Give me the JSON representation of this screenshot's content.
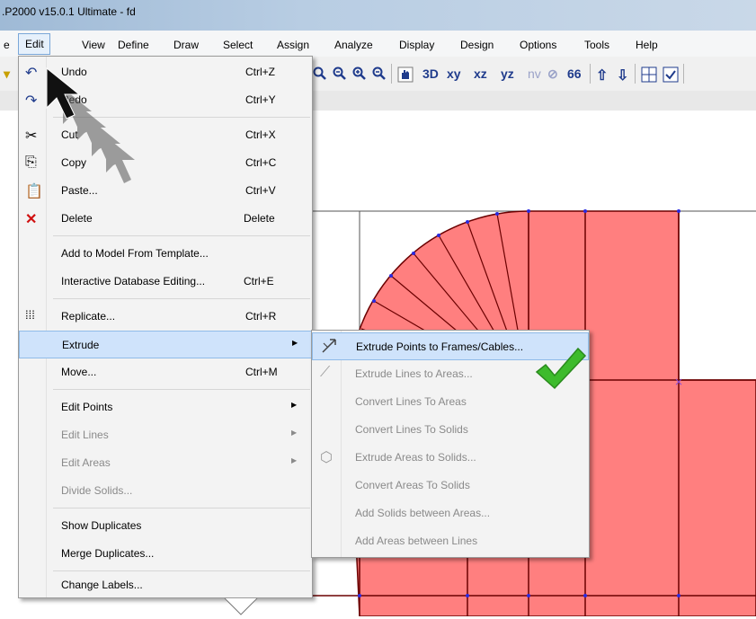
{
  "window": {
    "title": ".P2000 v15.0.1 Ultimate  - fd"
  },
  "menubar": {
    "items": [
      {
        "label": "e"
      },
      {
        "label": "Edit"
      },
      {
        "label": "View"
      },
      {
        "label": "Define"
      },
      {
        "label": "Draw"
      },
      {
        "label": "Select"
      },
      {
        "label": "Assign"
      },
      {
        "label": "Analyze"
      },
      {
        "label": "Display"
      },
      {
        "label": "Design"
      },
      {
        "label": "Options"
      },
      {
        "label": "Tools"
      },
      {
        "label": "Help"
      }
    ]
  },
  "toolbar": {
    "text_buttons": [
      "3D",
      "xy",
      "xz",
      "yz",
      "nv"
    ],
    "icons": [
      "zoom-window-icon",
      "zoom-in-icon",
      "zoom-out-icon",
      "zoom-restore-icon",
      "pan-icon",
      "rubber-band-icon",
      "up-arrow-icon",
      "down-arrow-icon",
      "grid-icon",
      "checkbox-icon"
    ]
  },
  "edit_menu": {
    "items": [
      {
        "label": "Undo",
        "shortcut": "Ctrl+Z",
        "icon": "undo-icon"
      },
      {
        "label": "Redo",
        "shortcut": "Ctrl+Y",
        "icon": "redo-icon"
      },
      {
        "label": "Cut",
        "shortcut": "Ctrl+X",
        "icon": "scissors-icon"
      },
      {
        "label": "Copy",
        "shortcut": "Ctrl+C",
        "icon": "copy-icon"
      },
      {
        "label": "Paste...",
        "shortcut": "Ctrl+V",
        "icon": "paste-icon"
      },
      {
        "label": "Delete",
        "shortcut": "Delete",
        "icon": "delete-x-icon"
      },
      {
        "label": "Add to Model From Template..."
      },
      {
        "label": "Interactive Database Editing...",
        "shortcut": "Ctrl+E"
      },
      {
        "label": "Replicate...",
        "shortcut": "Ctrl+R",
        "icon": "replicate-icon"
      },
      {
        "label": "Extrude"
      },
      {
        "label": "Move...",
        "shortcut": "Ctrl+M"
      },
      {
        "label": "Edit Points"
      },
      {
        "label": "Edit Lines"
      },
      {
        "label": "Edit Areas"
      },
      {
        "label": "Divide Solids..."
      },
      {
        "label": "Show Duplicates"
      },
      {
        "label": "Merge Duplicates..."
      },
      {
        "label": "Change Labels..."
      }
    ]
  },
  "extrude_submenu": {
    "items": [
      {
        "label": "Extrude Points to Frames/Cables...",
        "icon": "extrude-points-icon"
      },
      {
        "label": "Extrude Lines to Areas...",
        "icon": "extrude-lines-icon"
      },
      {
        "label": "Convert Lines To Areas"
      },
      {
        "label": "Convert Lines To Solids"
      },
      {
        "label": "Extrude Areas to Solids...",
        "icon": "extrude-areas-icon"
      },
      {
        "label": "Convert Areas To Solids"
      },
      {
        "label": "Add Solids between Areas..."
      },
      {
        "label": "Add Areas between Lines"
      }
    ]
  },
  "colors": {
    "model_fill": "#ff7f7f",
    "model_lines": "#6b0000",
    "node_points": "#2a2ae0",
    "menu_highlight": "#cfe3fb",
    "check_green": "#3dbb2c"
  }
}
